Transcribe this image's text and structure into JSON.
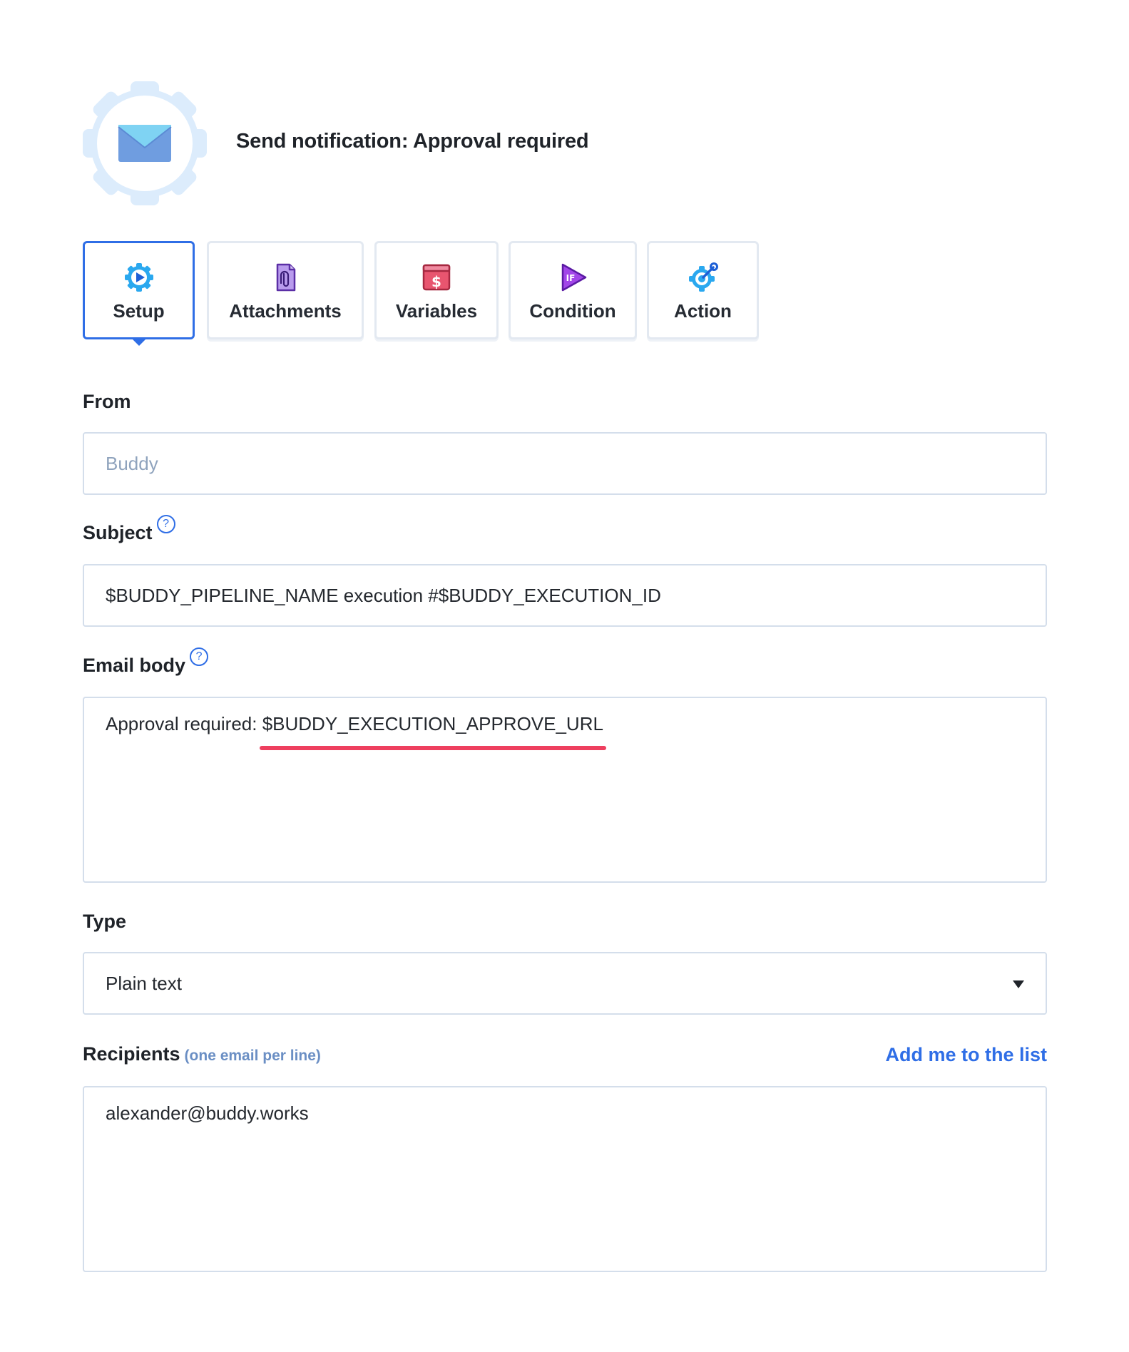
{
  "header": {
    "title": "Send notification: Approval required",
    "icon": "envelope-icon"
  },
  "tabs": [
    {
      "label": "Setup",
      "icon": "play-gear-icon",
      "active": true
    },
    {
      "label": "Attachments",
      "icon": "paperclip-file-icon",
      "active": false
    },
    {
      "label": "Variables",
      "icon": "dollar-icon",
      "active": false
    },
    {
      "label": "Condition",
      "icon": "if-play-icon",
      "active": false
    },
    {
      "label": "Action",
      "icon": "gear-wrench-icon",
      "active": false
    }
  ],
  "form": {
    "from": {
      "label": "From",
      "placeholder": "Buddy",
      "value": ""
    },
    "subject": {
      "label": "Subject",
      "value": "$BUDDY_PIPELINE_NAME execution #$BUDDY_EXECUTION_ID"
    },
    "email_body": {
      "label": "Email body",
      "value_prefix": "Approval required: ",
      "value_highlight": "$BUDDY_EXECUTION_APPROVE_URL"
    },
    "type": {
      "label": "Type",
      "value": "Plain text"
    },
    "recipients": {
      "label": "Recipients",
      "hint": "(one email per line)",
      "add_link": "Add me to the list",
      "value": "alexander@buddy.works"
    }
  },
  "colors": {
    "accent": "#2f6ee6",
    "highlight": "#ee3f5f",
    "border": "#d4deeb"
  }
}
